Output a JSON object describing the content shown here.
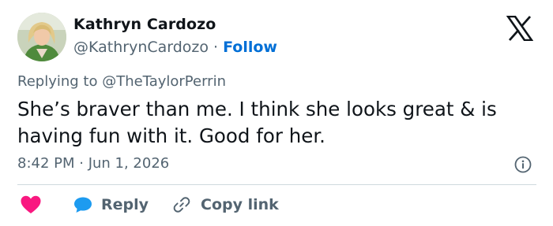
{
  "author": {
    "name": "Kathryn Cardozo",
    "handle": "@KathrynCardozo",
    "separator": "·",
    "follow_label": "Follow"
  },
  "reply_context": {
    "prefix": "Replying to ",
    "mention": "@TheTaylorPerrin"
  },
  "tweet": {
    "text": "She’s braver than me. I think she looks great & is having fun with it. Good for her.",
    "timestamp": "8:42 PM · Jun 1, 2026"
  },
  "actions": {
    "like_icon": "heart-icon",
    "reply_label": "Reply",
    "copy_link_label": "Copy link"
  },
  "colors": {
    "text": "#0f1419",
    "secondary": "#536471",
    "follow": "#006fd6",
    "heart": "#f91880",
    "reply_bubble": "#1d9bf0",
    "divider": "#cfd9de"
  }
}
